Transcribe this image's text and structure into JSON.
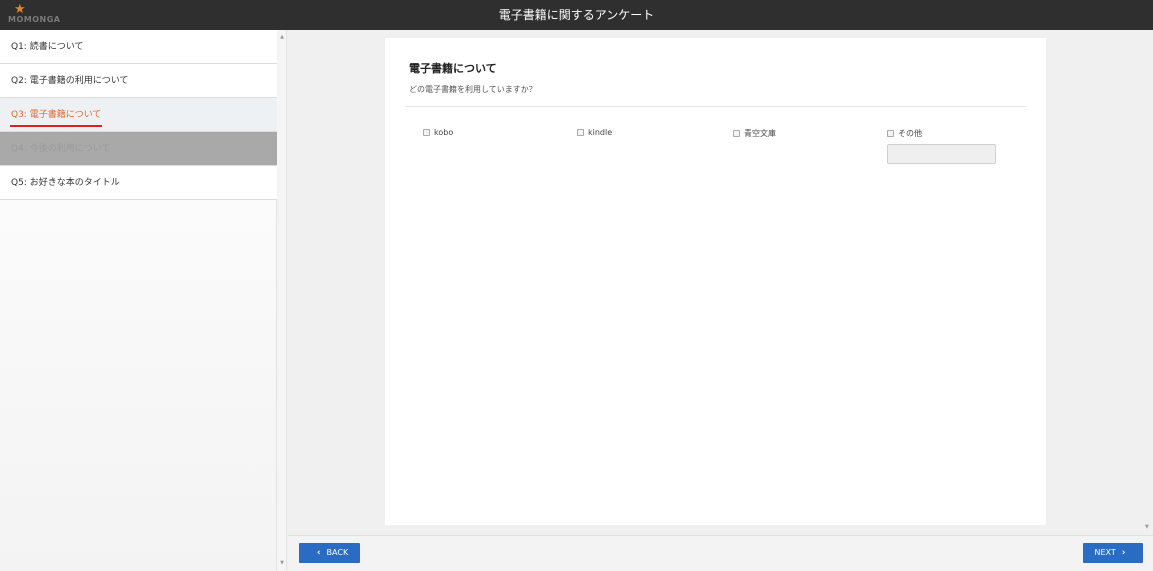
{
  "header": {
    "title": "電子書籍に関するアンケート",
    "logo_text": "MOMONGA",
    "logo_icon": "star-icon"
  },
  "sidebar": {
    "items": [
      {
        "label": "Q1: 読書について",
        "state": "normal"
      },
      {
        "label": "Q2: 電子書籍の利用について",
        "state": "normal"
      },
      {
        "label": "Q3: 電子書籍について",
        "state": "active"
      },
      {
        "label": "Q4: 今後の利用について",
        "state": "disabled"
      },
      {
        "label": "Q5: お好きな本のタイトル",
        "state": "normal"
      }
    ]
  },
  "question": {
    "title": "電子書籍について",
    "description": "どの電子書籍を利用していますか？",
    "options": [
      {
        "label": "kobo",
        "checked": false
      },
      {
        "label": "kindle",
        "checked": false
      },
      {
        "label": "青空文庫",
        "checked": false
      },
      {
        "label": "その他",
        "checked": false
      }
    ],
    "other_value": ""
  },
  "footer": {
    "back_label": "BACK",
    "next_label": "NEXT"
  },
  "colors": {
    "header_bg": "#2f2f2f",
    "accent_blue": "#2a6cc4",
    "active_text": "#e8662a",
    "active_underline": "#e02020",
    "disabled_bg": "#a9a9a9"
  }
}
